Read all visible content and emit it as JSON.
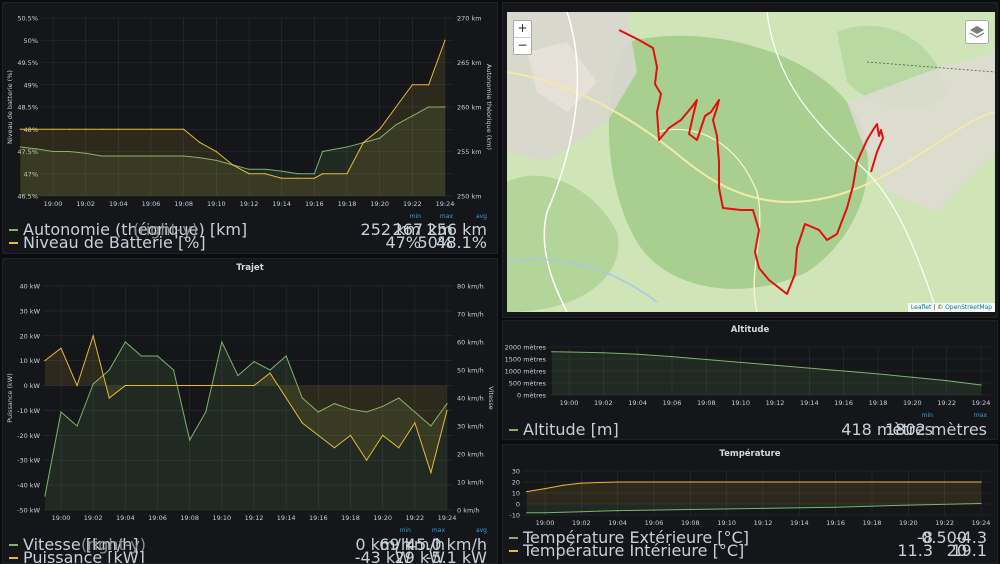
{
  "battery_panel": {
    "y_left_label": "Niveau de batterie (%)",
    "y_right_label": "Autonomie théorique (km)",
    "y_left_ticks": [
      "50.5%",
      "50%",
      "49.5%",
      "49%",
      "48.5%",
      "48%",
      "47.5%",
      "47%",
      "46.5%"
    ],
    "y_right_ticks": [
      "270 km",
      "265 km",
      "260 km",
      "255 km",
      "250 km"
    ],
    "x_ticks": [
      "19:00",
      "19:02",
      "19:04",
      "19:06",
      "19:08",
      "19:10",
      "19:12",
      "19:14",
      "19:16",
      "19:18",
      "19:20",
      "19:22",
      "19:24"
    ],
    "legend_header": {
      "min": "min",
      "max": "max",
      "avg": "avg"
    },
    "legend": [
      {
        "name": "Autonomie (théorique) [km]",
        "axis": "(right-y)",
        "min": "252 km",
        "max": "267 km",
        "avg": "256 km",
        "color": "#7eb26d"
      },
      {
        "name": "Niveau de Batterie [%]",
        "axis": "",
        "min": "47%",
        "max": "50%",
        "avg": "48.1%",
        "color": "#eab839"
      }
    ]
  },
  "trajet_panel": {
    "title": "Trajet",
    "y_left_label": "Puissance (kW)",
    "y_right_label": "Vitesse",
    "y_left_ticks": [
      "40 kW",
      "30 kW",
      "20 kW",
      "10 kW",
      "0 kW",
      "-10 kW",
      "-20 kW",
      "-30 kW",
      "-40 kW",
      "-50 kW"
    ],
    "y_right_ticks": [
      "80 km/h",
      "70 km/h",
      "60 km/h",
      "50 km/h",
      "40 km/h",
      "30 km/h",
      "20 km/h",
      "10 km/h",
      "0 km/h"
    ],
    "x_ticks": [
      "19:00",
      "19:02",
      "19:04",
      "19:06",
      "19:08",
      "19:10",
      "19:12",
      "19:14",
      "19:16",
      "19:18",
      "19:20",
      "19:22",
      "19:24"
    ],
    "legend_header": {
      "min": "min",
      "max": "max",
      "avg": "avg"
    },
    "legend": [
      {
        "name": "Vitesse [km/h]",
        "axis": "(right-y)",
        "min": "0 km/h",
        "max": "69 km/h",
        "avg": "45.0 km/h",
        "color": "#7eb26d"
      },
      {
        "name": "Puissance [kW]",
        "axis": "",
        "min": "-43 kW",
        "max": "29 kW",
        "avg": "-5.1 kW",
        "color": "#eab839"
      }
    ]
  },
  "map_panel": {
    "zoom_in": "+",
    "zoom_out": "−",
    "attribution_leaflet": "Leaflet",
    "attribution_sep": " | © ",
    "attribution_osm": "OpenStreetMap"
  },
  "altitude_panel": {
    "title": "Altitude",
    "y_ticks": [
      "2000 mètres",
      "1500 mètres",
      "1000 mètres",
      "500 mètres",
      "0 mètres"
    ],
    "x_ticks": [
      "19:00",
      "19:02",
      "19:04",
      "19:06",
      "19:08",
      "19:10",
      "19:12",
      "19:14",
      "19:16",
      "19:18",
      "19:20",
      "19:22",
      "19:24"
    ],
    "legend_header": {
      "min": "min",
      "max": "max"
    },
    "legend": [
      {
        "name": "Altitude [m]",
        "min": "418 mètres",
        "max": "1802 mètres",
        "color": "#7eb26d"
      }
    ]
  },
  "temperature_panel": {
    "title": "Température",
    "y_ticks": [
      "30",
      "20",
      "10",
      "0",
      "-10"
    ],
    "x_ticks": [
      "19:00",
      "19:02",
      "19:04",
      "19:06",
      "19:08",
      "19:10",
      "19:12",
      "19:14",
      "19:16",
      "19:18",
      "19:20",
      "19:22",
      "19:24"
    ],
    "legend": [
      {
        "name": "Température Extérieure [°C]",
        "min": "-8",
        "max": "0.500",
        "avg": "-4.3",
        "color": "#7eb26d"
      },
      {
        "name": "Température Intérieure [°C]",
        "min": "11.3",
        "max": "20",
        "avg": "19.1",
        "color": "#eab839"
      }
    ]
  },
  "chart_data": [
    {
      "type": "line",
      "title": "",
      "x": [
        "18:58",
        "18:59",
        "19:00",
        "19:01",
        "19:02",
        "19:03",
        "19:04",
        "19:06",
        "19:08",
        "19:09",
        "19:10",
        "19:11",
        "19:12",
        "19:13",
        "19:14",
        "19:15",
        "19:16",
        "19:16.5",
        "19:18",
        "19:19",
        "19:20",
        "19:21",
        "19:22",
        "19:23",
        "19:24"
      ],
      "series": [
        {
          "name": "Autonomie (théorique) [km]",
          "axis": "right",
          "unit": "km",
          "values": [
            255.5,
            255.3,
            255,
            255,
            254.8,
            254.5,
            254.5,
            254.5,
            254.5,
            254.3,
            254,
            253.5,
            253,
            253,
            252.8,
            252.5,
            252.5,
            255,
            255.5,
            256,
            256.5,
            258,
            259,
            260,
            260
          ]
        },
        {
          "name": "Niveau de Batterie [%]",
          "axis": "left",
          "unit": "%",
          "values": [
            48,
            48,
            48,
            48,
            48,
            48,
            48,
            48,
            48,
            47.7,
            47.5,
            47.2,
            47,
            47,
            46.9,
            46.9,
            46.9,
            47,
            47,
            47.7,
            48,
            48.5,
            49,
            49,
            50
          ]
        }
      ],
      "ylim_left": [
        46.5,
        50.5
      ],
      "ylim_right": [
        250,
        270
      ],
      "grid": true
    },
    {
      "type": "line",
      "title": "Trajet",
      "x": [
        "18:59",
        "19:00",
        "19:01",
        "19:02",
        "19:03",
        "19:04",
        "19:05",
        "19:06",
        "19:07",
        "19:08",
        "19:09",
        "19:10",
        "19:11",
        "19:12",
        "19:13",
        "19:14",
        "19:15",
        "19:16",
        "19:17",
        "19:18",
        "19:19",
        "19:20",
        "19:21",
        "19:22",
        "19:23",
        "19:24"
      ],
      "series": [
        {
          "name": "Vitesse [km/h]",
          "axis": "right",
          "unit": "km/h",
          "values": [
            5,
            35,
            30,
            45,
            50,
            60,
            55,
            55,
            50,
            25,
            35,
            60,
            48,
            53,
            50,
            55,
            40,
            35,
            38,
            36,
            35,
            37,
            40,
            35,
            30,
            38
          ]
        },
        {
          "name": "Puissance [kW]",
          "axis": "left",
          "unit": "kW",
          "values": [
            10,
            15,
            0,
            20,
            -5,
            0,
            0,
            0,
            0,
            0,
            0,
            0,
            0,
            0,
            5,
            -5,
            -15,
            -20,
            -25,
            -20,
            -30,
            -20,
            -25,
            -15,
            -35,
            -10
          ]
        }
      ],
      "ylim_left": [
        -50,
        40
      ],
      "ylim_right": [
        0,
        80
      ],
      "grid": true
    },
    {
      "type": "line",
      "title": "Altitude",
      "x": [
        "18:59",
        "19:00",
        "19:02",
        "19:04",
        "19:06",
        "19:08",
        "19:10",
        "19:12",
        "19:14",
        "19:16",
        "19:18",
        "19:20",
        "19:22",
        "19:24"
      ],
      "series": [
        {
          "name": "Altitude [m]",
          "unit": "m",
          "values": [
            1802,
            1790,
            1760,
            1700,
            1600,
            1480,
            1360,
            1240,
            1120,
            1000,
            880,
            740,
            600,
            418
          ]
        }
      ],
      "ylim": [
        0,
        2000
      ],
      "grid": true
    },
    {
      "type": "line",
      "title": "Température",
      "x": [
        "18:59",
        "19:00",
        "19:01",
        "19:02",
        "19:03",
        "19:04",
        "19:08",
        "19:12",
        "19:16",
        "19:20",
        "19:24"
      ],
      "series": [
        {
          "name": "Température Extérieure [°C]",
          "unit": "°C",
          "values": [
            -8,
            -8,
            -7.5,
            -7,
            -6.5,
            -6,
            -5,
            -4,
            -3,
            -1,
            0.5
          ]
        },
        {
          "name": "Température Intérieure [°C]",
          "unit": "°C",
          "values": [
            11.3,
            14,
            17,
            19,
            19.5,
            20,
            20,
            20,
            20,
            20,
            20
          ]
        }
      ],
      "ylim": [
        -10,
        30
      ],
      "grid": true
    }
  ]
}
